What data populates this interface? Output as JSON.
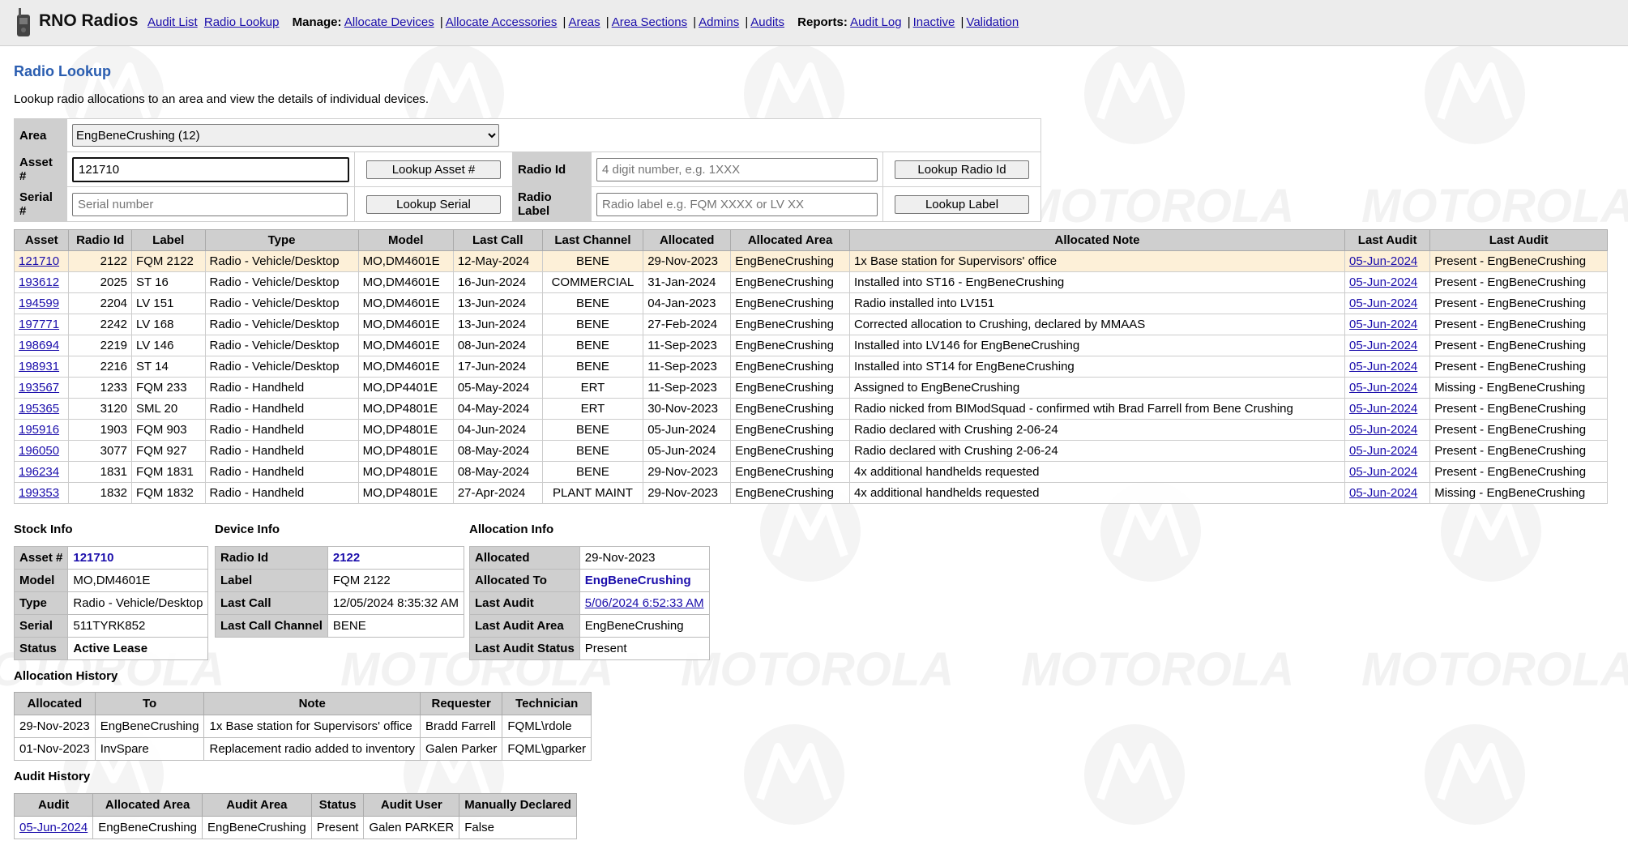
{
  "app": {
    "title": "RNO Radios"
  },
  "nav": {
    "audit_list": "Audit List",
    "radio_lookup": "Radio Lookup",
    "manage_label": "Manage:",
    "allocate_devices": "Allocate Devices",
    "allocate_accessories": "Allocate Accessories",
    "areas": "Areas",
    "area_sections": "Area Sections",
    "admins": "Admins",
    "audits": "Audits",
    "reports_label": "Reports:",
    "audit_log": "Audit Log",
    "inactive": "Inactive",
    "validation": "Validation",
    "separator": "|"
  },
  "page": {
    "title": "Radio Lookup",
    "description": "Lookup radio allocations to an area and view the details of individual devices."
  },
  "form": {
    "area_label": "Area",
    "area_selected": "EngBeneCrushing (12)",
    "asset_label": "Asset #",
    "asset_value": "121710",
    "lookup_asset_btn": "Lookup Asset #",
    "radio_id_label": "Radio Id",
    "radio_id_placeholder": "4 digit number, e.g. 1XXX",
    "lookup_radio_btn": "Lookup Radio Id",
    "serial_label": "Serial #",
    "serial_placeholder": "Serial number",
    "lookup_serial_btn": "Lookup Serial",
    "radio_label_label": "Radio Label",
    "radio_label_placeholder": "Radio label e.g. FQM XXXX or LV XX",
    "lookup_label_btn": "Lookup Label"
  },
  "grid": {
    "headers": [
      "Asset",
      "Radio Id",
      "Label",
      "Type",
      "Model",
      "Last Call",
      "Last Channel",
      "Allocated",
      "Allocated Area",
      "Allocated Note",
      "Last Audit",
      "Last Audit"
    ],
    "rows": [
      [
        "121710",
        "2122",
        "FQM 2122",
        "Radio - Vehicle/Desktop",
        "MO,DM4601E",
        "12-May-2024",
        "BENE",
        "29-Nov-2023",
        "EngBeneCrushing",
        "1x Base station for Supervisors' office",
        "05-Jun-2024",
        "Present - EngBeneCrushing"
      ],
      [
        "193612",
        "2025",
        "ST 16",
        "Radio - Vehicle/Desktop",
        "MO,DM4601E",
        "16-Jun-2024",
        "COMMERCIAL",
        "31-Jan-2024",
        "EngBeneCrushing",
        "Installed into ST16 - EngBeneCrushing",
        "05-Jun-2024",
        "Present - EngBeneCrushing"
      ],
      [
        "194599",
        "2204",
        "LV 151",
        "Radio - Vehicle/Desktop",
        "MO,DM4601E",
        "13-Jun-2024",
        "BENE",
        "04-Jan-2023",
        "EngBeneCrushing",
        "Radio installed into LV151",
        "05-Jun-2024",
        "Present - EngBeneCrushing"
      ],
      [
        "197771",
        "2242",
        "LV 168",
        "Radio - Vehicle/Desktop",
        "MO,DM4601E",
        "13-Jun-2024",
        "BENE",
        "27-Feb-2024",
        "EngBeneCrushing",
        "Corrected allocation to Crushing, declared by MMAAS",
        "05-Jun-2024",
        "Present - EngBeneCrushing"
      ],
      [
        "198694",
        "2219",
        "LV 146",
        "Radio - Vehicle/Desktop",
        "MO,DM4601E",
        "08-Jun-2024",
        "BENE",
        "11-Sep-2023",
        "EngBeneCrushing",
        "Installed into LV146 for EngBeneCrushing",
        "05-Jun-2024",
        "Present - EngBeneCrushing"
      ],
      [
        "198931",
        "2216",
        "ST 14",
        "Radio - Vehicle/Desktop",
        "MO,DM4601E",
        "17-Jun-2024",
        "BENE",
        "11-Sep-2023",
        "EngBeneCrushing",
        "Installed into ST14 for EngBeneCrushing",
        "05-Jun-2024",
        "Present - EngBeneCrushing"
      ],
      [
        "193567",
        "1233",
        "FQM 233",
        "Radio - Handheld",
        "MO,DP4401E",
        "05-May-2024",
        "ERT",
        "11-Sep-2023",
        "EngBeneCrushing",
        "Assigned to EngBeneCrushing",
        "05-Jun-2024",
        "Missing - EngBeneCrushing"
      ],
      [
        "195365",
        "3120",
        "SML 20",
        "Radio - Handheld",
        "MO,DP4801E",
        "04-May-2024",
        "ERT",
        "30-Nov-2023",
        "EngBeneCrushing",
        "Radio nicked from BIModSquad - confirmed wtih Brad Farrell from Bene Crushing",
        "05-Jun-2024",
        "Present - EngBeneCrushing"
      ],
      [
        "195916",
        "1903",
        "FQM 903",
        "Radio - Handheld",
        "MO,DP4801E",
        "04-Jun-2024",
        "BENE",
        "05-Jun-2024",
        "EngBeneCrushing",
        "Radio declared with Crushing 2-06-24",
        "05-Jun-2024",
        "Present - EngBeneCrushing"
      ],
      [
        "196050",
        "3077",
        "FQM 927",
        "Radio - Handheld",
        "MO,DP4801E",
        "08-May-2024",
        "BENE",
        "05-Jun-2024",
        "EngBeneCrushing",
        "Radio declared with Crushing 2-06-24",
        "05-Jun-2024",
        "Present - EngBeneCrushing"
      ],
      [
        "196234",
        "1831",
        "FQM 1831",
        "Radio - Handheld",
        "MO,DP4801E",
        "08-May-2024",
        "BENE",
        "29-Nov-2023",
        "EngBeneCrushing",
        "4x additional handhelds requested",
        "05-Jun-2024",
        "Present - EngBeneCrushing"
      ],
      [
        "199353",
        "1832",
        "FQM 1832",
        "Radio - Handheld",
        "MO,DP4801E",
        "27-Apr-2024",
        "PLANT MAINT",
        "29-Nov-2023",
        "EngBeneCrushing",
        "4x additional handhelds requested",
        "05-Jun-2024",
        "Missing - EngBeneCrushing"
      ]
    ]
  },
  "stock_info": {
    "title": "Stock Info",
    "rows": [
      {
        "k": "Asset #",
        "v": "121710"
      },
      {
        "k": "Model",
        "v": "MO,DM4601E"
      },
      {
        "k": "Type",
        "v": "Radio - Vehicle/Desktop"
      },
      {
        "k": "Serial",
        "v": "511TYRK852"
      },
      {
        "k": "Status",
        "v": "Active Lease"
      }
    ]
  },
  "device_info": {
    "title": "Device Info",
    "rows": [
      {
        "k": "Radio Id",
        "v": "2122"
      },
      {
        "k": "Label",
        "v": "FQM 2122"
      },
      {
        "k": "Last Call",
        "v": "12/05/2024 8:35:32 AM"
      },
      {
        "k": "Last Call Channel",
        "v": "BENE"
      }
    ]
  },
  "allocation_info": {
    "title": "Allocation Info",
    "rows": [
      {
        "k": "Allocated",
        "v": "29-Nov-2023"
      },
      {
        "k": "Allocated To",
        "v": "EngBeneCrushing"
      },
      {
        "k": "Last Audit",
        "v": "5/06/2024 6:52:33 AM"
      },
      {
        "k": "Last Audit Area",
        "v": "EngBeneCrushing"
      },
      {
        "k": "Last Audit Status",
        "v": "Present"
      }
    ]
  },
  "allocation_history": {
    "title": "Allocation History",
    "headers": [
      "Allocated",
      "To",
      "Note",
      "Requester",
      "Technician"
    ],
    "rows": [
      [
        "29-Nov-2023",
        "EngBeneCrushing",
        "1x Base station for Supervisors' office",
        "Bradd Farrell",
        "FQML\\rdole"
      ],
      [
        "01-Nov-2023",
        "InvSpare",
        "Replacement radio added to inventory",
        "Galen Parker",
        "FQML\\gparker"
      ]
    ]
  },
  "audit_history": {
    "title": "Audit History",
    "headers": [
      "Audit",
      "Allocated Area",
      "Audit Area",
      "Status",
      "Audit User",
      "Manually Declared"
    ],
    "rows": [
      [
        "05-Jun-2024",
        "EngBeneCrushing",
        "EngBeneCrushing",
        "Present",
        "Galen PARKER",
        "False"
      ]
    ]
  },
  "watermark": {
    "text": "MOTOROLA"
  }
}
